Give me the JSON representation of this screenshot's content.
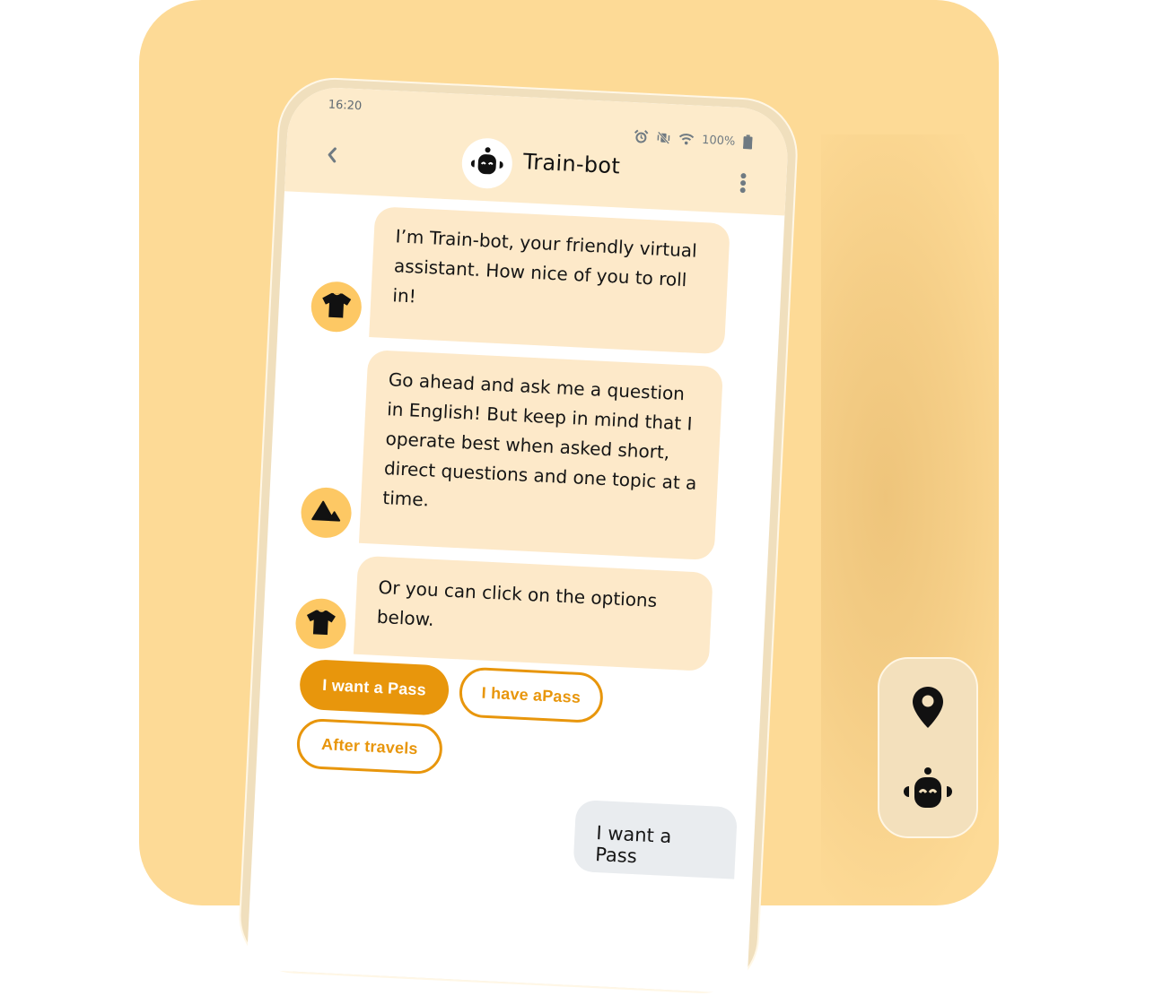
{
  "colors": {
    "background_card": "#fdda96",
    "accent": "#e8960c",
    "bot_bubble": "#fde9c9",
    "user_bubble": "#e9ecef",
    "avatar_bg": "#fdc864",
    "header_bg": "#fdebcb"
  },
  "status_bar": {
    "time": "16:20",
    "icons": [
      "alarm-icon",
      "vibrate-off-icon",
      "wifi-icon",
      "battery-icon"
    ],
    "battery": "100%"
  },
  "header": {
    "back_icon": "chevron-left-icon",
    "title": "Train-bot",
    "avatar_icon": "robot-icon",
    "menu_icon": "kebab-menu-icon"
  },
  "messages": [
    {
      "sender": "bot",
      "avatar_icon": "tshirt-icon",
      "text": "I’m Train-bot, your friendly virtual assistant. How nice of you to roll in!"
    },
    {
      "sender": "bot",
      "avatar_icon": "mountain-icon",
      "text": "Go ahead and ask me a question in English! But keep in mind that I operate best when asked short, direct questions and one topic at a time."
    },
    {
      "sender": "bot",
      "avatar_icon": "tshirt-icon",
      "text": "Or you can click on the options below."
    }
  ],
  "options": [
    {
      "label": "I want a Pass",
      "selected": true
    },
    {
      "label": "I have aPass",
      "selected": false
    },
    {
      "label": "After travels",
      "selected": false
    }
  ],
  "user_message": {
    "text": "I want a Pass"
  },
  "dock": {
    "items": [
      {
        "icon": "location-pin-icon"
      },
      {
        "icon": "robot-icon"
      }
    ]
  }
}
